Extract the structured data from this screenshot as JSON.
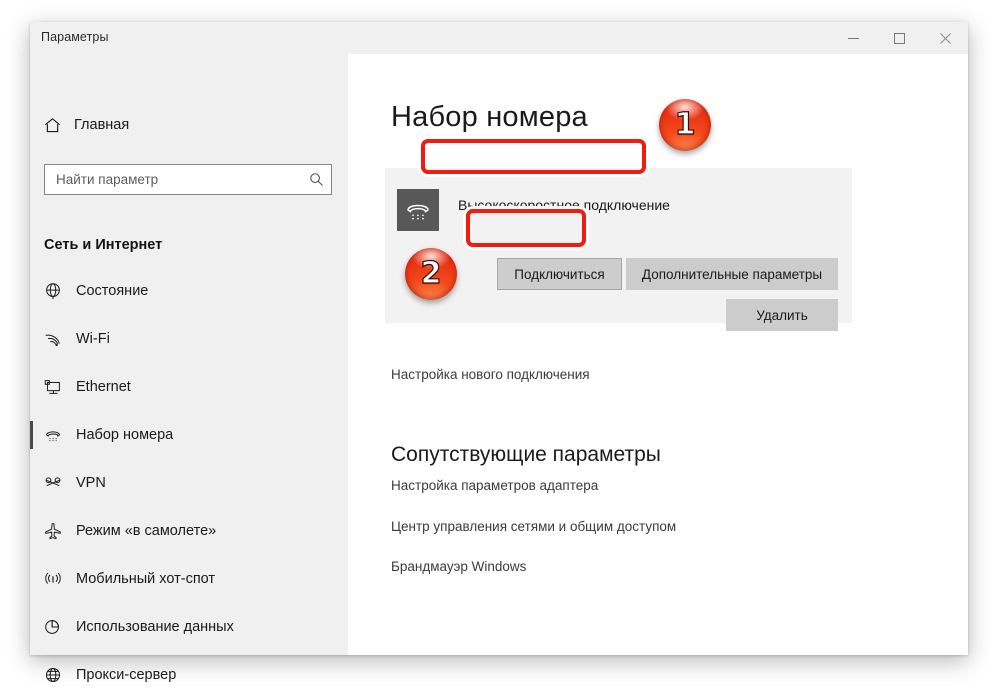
{
  "window": {
    "title": "Параметры",
    "controls": {
      "minimize": "minimize-icon",
      "maximize": "maximize-icon",
      "close": "close-icon"
    }
  },
  "sidebar": {
    "home": {
      "label": "Главная",
      "icon": "home-icon"
    },
    "search": {
      "value": "",
      "placeholder": "Найти параметр",
      "icon": "search-icon"
    },
    "section_title": "Сеть и Интернет",
    "items": [
      {
        "label": "Состояние",
        "icon": "globe-status-icon",
        "selected": false
      },
      {
        "label": "Wi-Fi",
        "icon": "wifi-icon",
        "selected": false
      },
      {
        "label": "Ethernet",
        "icon": "ethernet-icon",
        "selected": false
      },
      {
        "label": "Набор номера",
        "icon": "dialup-icon",
        "selected": true
      },
      {
        "label": "VPN",
        "icon": "vpn-icon",
        "selected": false
      },
      {
        "label": "Режим «в самолете»",
        "icon": "airplane-icon",
        "selected": false
      },
      {
        "label": "Мобильный хот-спот",
        "icon": "hotspot-icon",
        "selected": false
      },
      {
        "label": "Использование данных",
        "icon": "data-usage-icon",
        "selected": false
      },
      {
        "label": "Прокси-сервер",
        "icon": "proxy-globe-icon",
        "selected": false
      }
    ]
  },
  "main": {
    "page_title": "Набор номера",
    "connection": {
      "name": "Высокоскоростное подключение",
      "icon": "dialup-phone-icon",
      "buttons": {
        "connect": "Подключиться",
        "advanced": "Дополнительные параметры",
        "delete": "Удалить"
      }
    },
    "new_connection_link": "Настройка нового подключения",
    "related": {
      "title": "Сопутствующие параметры",
      "links": [
        "Настройка параметров адаптера",
        "Центр управления сетями и общим доступом",
        "Брандмауэр Windows"
      ]
    }
  },
  "annotations": {
    "badges": [
      {
        "number": "1",
        "target": "connection-name"
      },
      {
        "number": "2",
        "target": "connect-button"
      }
    ],
    "highlight_color": "#ee1c11"
  }
}
